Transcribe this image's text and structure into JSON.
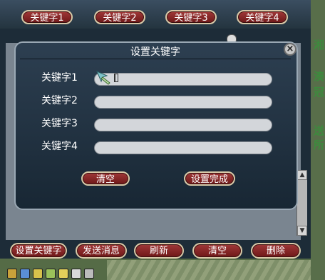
{
  "top_keywords": [
    "关键字1",
    "关键字2",
    "关键字3",
    "关键字4"
  ],
  "dialog": {
    "title": "设置关键字",
    "close_label": "×",
    "fields": [
      {
        "label": "关键字1",
        "value": ""
      },
      {
        "label": "关键字2",
        "value": ""
      },
      {
        "label": "关键字3",
        "value": ""
      },
      {
        "label": "关键字4",
        "value": ""
      }
    ],
    "clear_label": "清空",
    "done_label": "设置完成"
  },
  "bottom_buttons": [
    "设置关键字",
    "发送消息",
    "刷新",
    "清空",
    "删除"
  ],
  "side_text": [
    "湘",
    "湊",
    "冠",
    "送",
    "所"
  ],
  "scroll": {
    "up": "▲",
    "down": "▼"
  },
  "colors": {
    "button": "#8a2626",
    "dialog_bg": "#223241",
    "field": "#d3d6da"
  }
}
